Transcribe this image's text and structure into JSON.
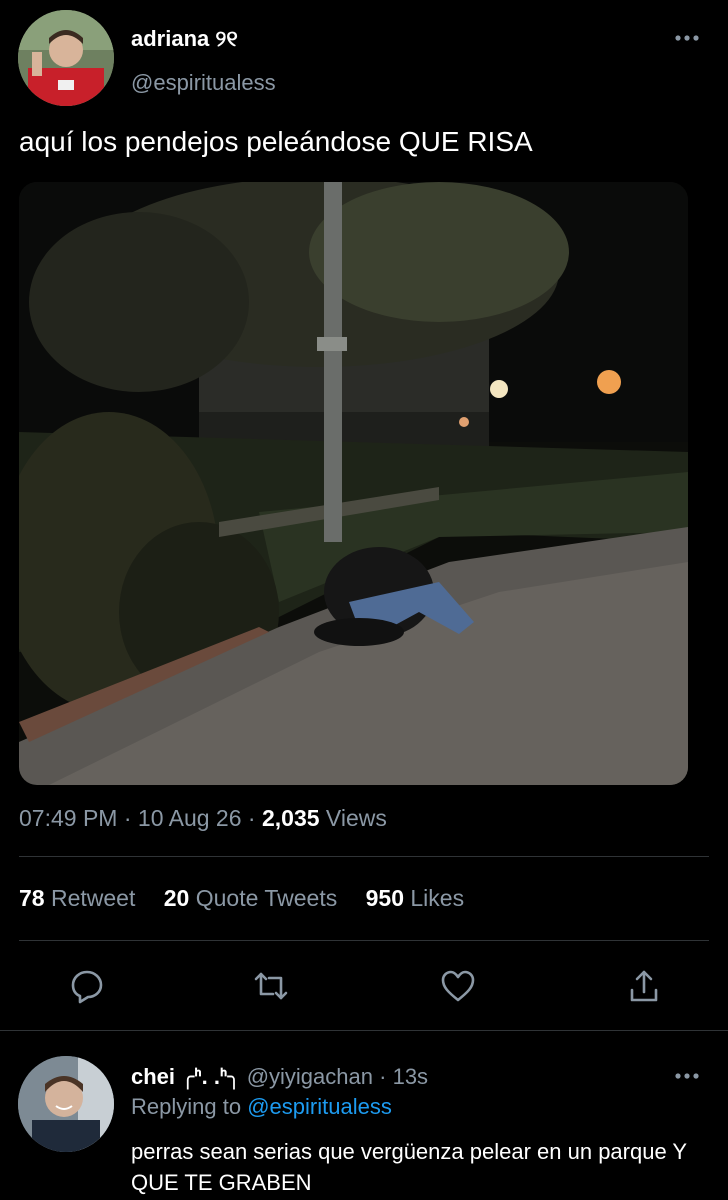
{
  "tweet": {
    "author_name": "adriana ୨୧",
    "author_handle": "@espiritualess",
    "text": "aquí los pendejos peleándose QUE RISA",
    "time": "07:49 PM",
    "date": "10 Aug 26",
    "views_count": "2,035",
    "views_label": "Views",
    "retweets_count": "78",
    "retweets_label": "Retweet",
    "quotes_count": "20",
    "quotes_label": "Quote Tweets",
    "likes_count": "950",
    "likes_label": "Likes",
    "separator": "·"
  },
  "icons": {
    "more": "more-horizontal-icon",
    "reply": "reply-icon",
    "retweet": "retweet-icon",
    "like": "heart-icon",
    "share": "share-icon"
  },
  "reply": {
    "author_name": "chei ╭ᑋ. .ᑋ╮",
    "author_handle": "@yiyigachan",
    "time": "13s",
    "replying_prefix": "Replying to",
    "replying_handle": "@espiritualess",
    "text": "perras sean serias que vergüenza pelear en un parque Y QUE TE GRABEN"
  },
  "colors": {
    "background": "#000000",
    "text": "#e7e9ea",
    "secondary": "#8b98a5",
    "link": "#1d9bf0",
    "divider": "#2f3336"
  }
}
